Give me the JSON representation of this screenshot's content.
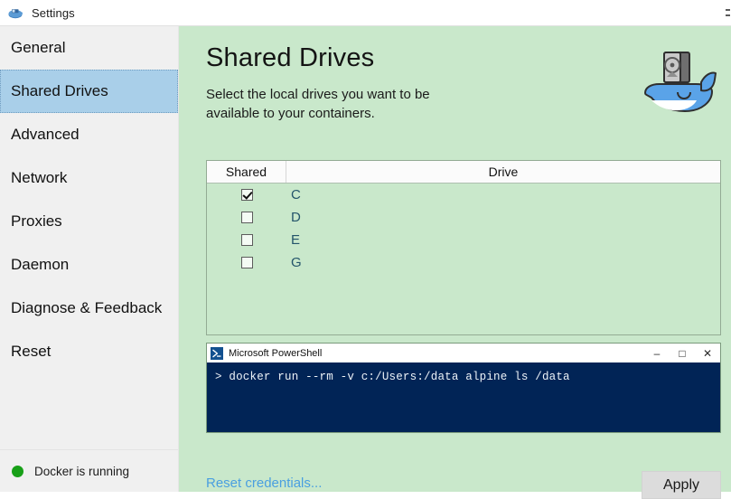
{
  "window": {
    "title": "Settings",
    "icon": "docker-whale-icon",
    "overflow_menu": "more-options-icon"
  },
  "sidebar": {
    "items": [
      {
        "label": "General",
        "selected": false
      },
      {
        "label": "Shared Drives",
        "selected": true
      },
      {
        "label": "Advanced",
        "selected": false
      },
      {
        "label": "Network",
        "selected": false
      },
      {
        "label": "Proxies",
        "selected": false
      },
      {
        "label": "Daemon",
        "selected": false
      },
      {
        "label": "Diagnose & Feedback",
        "selected": false
      },
      {
        "label": "Reset",
        "selected": false
      }
    ],
    "status": {
      "text": "Docker is running",
      "indicator_color": "#18a018"
    }
  },
  "main": {
    "title": "Shared Drives",
    "subtitle": "Select the local drives you want to be available to your containers.",
    "logo_icon": "docker-whale-with-harddrive-icon",
    "background_color": "#c9e8cb",
    "table": {
      "columns": [
        "Shared",
        "Drive"
      ],
      "rows": [
        {
          "drive": "C",
          "shared": true
        },
        {
          "drive": "D",
          "shared": false
        },
        {
          "drive": "E",
          "shared": false
        },
        {
          "drive": "G",
          "shared": false
        }
      ]
    },
    "console": {
      "title": "Microsoft PowerShell",
      "icon": "powershell-icon",
      "minimize_label": "–",
      "maximize_label": "□",
      "close_label": "✕",
      "line": "> docker run --rm -v c:/Users:/data alpine ls /data",
      "background_color": "#012456"
    },
    "reset_credentials_label": "Reset credentials...",
    "apply_label": "Apply",
    "link_color": "#4a9fe0"
  }
}
